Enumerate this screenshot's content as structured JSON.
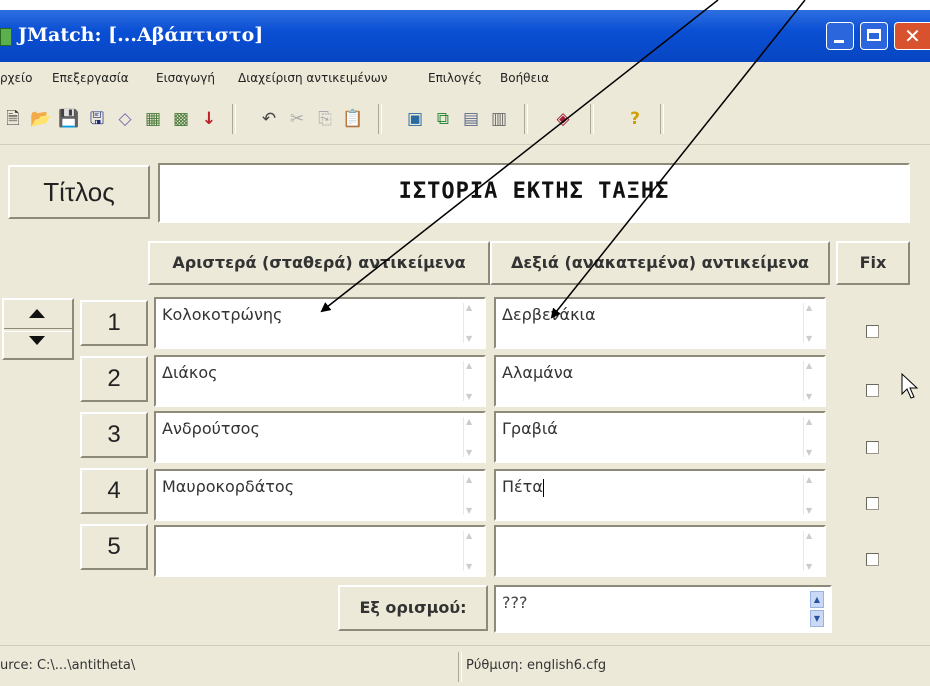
{
  "window": {
    "title": "JMatch: [...Αβάπτιστο]"
  },
  "menu": [
    "ρχείο",
    "Επεξεργασία",
    "Εισαγωγή",
    "Διαχείριση αντικειμένων",
    "Επιλογές",
    "Βοήθεια"
  ],
  "toolbar_icons": [
    "new-file-icon",
    "open-folder-icon",
    "save-icon",
    "save-as-icon",
    "eraser-icon",
    "view-icon",
    "view-alt-icon",
    "download-arrow-icon",
    "undo-icon",
    "cut-icon",
    "copy-icon",
    "paste-icon",
    "export-web-icon",
    "export-alt-icon",
    "export-drag-icon",
    "export-multi-icon",
    "config-icon",
    "help-icon"
  ],
  "title_label": "Τίτλος",
  "title_value": "ΙΣΤΟΡΙΑ ΕΚΤΗΣ ΤΑΞΗΣ",
  "headers": {
    "left": "Αριστερά (σταθερά) αντικείμενα",
    "right": "Δεξιά (ανακατεμένα) αντικείμενα",
    "fix": "Fix"
  },
  "rows": [
    {
      "num": "1",
      "left": "Κολοκοτρώνης",
      "right": "Δερβενάκια",
      "fixed": false
    },
    {
      "num": "2",
      "left": "Διάκος",
      "right": "Αλαμάνα",
      "fixed": false
    },
    {
      "num": "3",
      "left": "Ανδρούτσος",
      "right": "Γραβιά",
      "fixed": false
    },
    {
      "num": "4",
      "left": "Μαυροκορδάτος",
      "right": "Πέτα",
      "fixed": false
    },
    {
      "num": "5",
      "left": "",
      "right": "",
      "fixed": false
    }
  ],
  "default": {
    "label": "Εξ ορισμού:",
    "value": "???"
  },
  "status": {
    "source": "urce: C:\\...\\antitheta\\",
    "config": "Ρύθμιση: english6.cfg"
  }
}
